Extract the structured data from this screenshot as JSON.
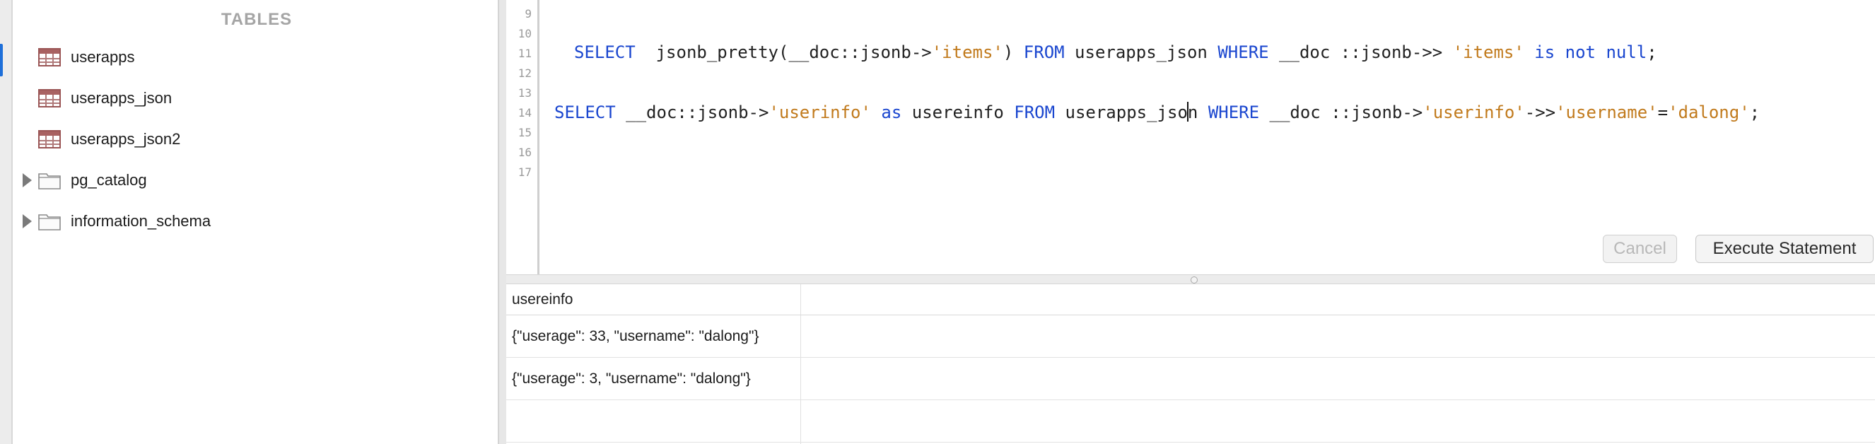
{
  "sidebar": {
    "header": "TABLES",
    "items": [
      {
        "label": "userapps",
        "type": "table"
      },
      {
        "label": "userapps_json",
        "type": "table"
      },
      {
        "label": "userapps_json2",
        "type": "table"
      },
      {
        "label": "pg_catalog",
        "type": "schema"
      },
      {
        "label": "information_schema",
        "type": "schema"
      }
    ]
  },
  "editor": {
    "line_numbers": [
      "9",
      "10",
      "11",
      "12",
      "13",
      "14",
      "15",
      "16",
      "17"
    ],
    "line11": {
      "t1": "SELECT",
      "t2": "  jsonb_pretty(__doc::jsonb->",
      "t3": "'items'",
      "t4": ") ",
      "t5": "FROM",
      "t6": " userapps_json ",
      "t7": "WHERE",
      "t8": " __doc ::jsonb->> ",
      "t9": "'items'",
      "t10": " ",
      "t11": "is not null",
      "t12": ";"
    },
    "line14": {
      "t1": "SELECT",
      "t2": " __doc::jsonb->",
      "t3": "'userinfo'",
      "t4": " ",
      "t5": "as",
      "t6": " usereinfo ",
      "t7": "FROM",
      "t8a": " userapps_jso",
      "t8b": "n ",
      "t9": "WHERE",
      "t10": " __doc ::jsonb->",
      "t11": "'userinfo'",
      "t12": "->>",
      "t13": "'username'",
      "t14": "=",
      "t15": "'dalong'",
      "t16": ";"
    },
    "cancel_label": "Cancel",
    "execute_label": "Execute Statement"
  },
  "results": {
    "column": "usereinfo",
    "rows": [
      "{\"userage\": 33, \"username\": \"dalong\"}",
      "{\"userage\": 3, \"username\": \"dalong\"}"
    ]
  },
  "colors": {
    "keyword": "#1a46cf",
    "string": "#c17a1c",
    "table_icon": "#a96262"
  }
}
